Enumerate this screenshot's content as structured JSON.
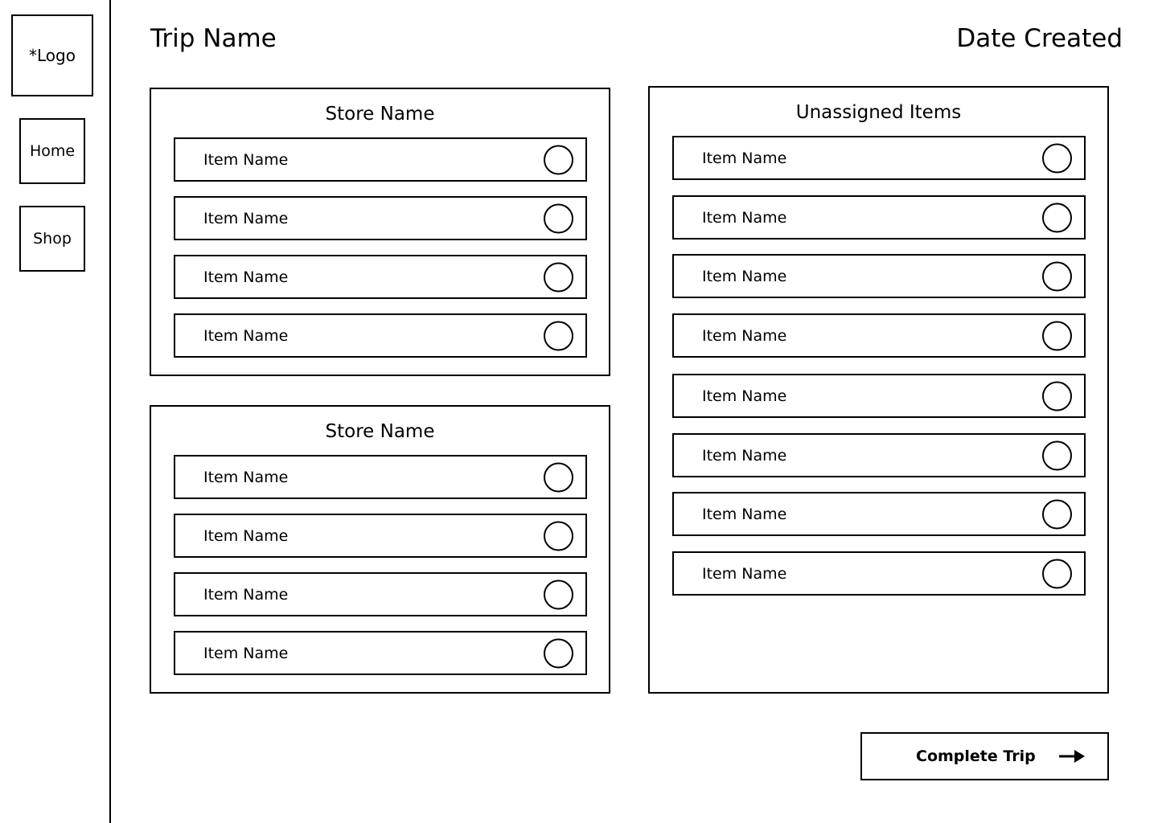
{
  "sidebar": {
    "logo_label": "*Logo",
    "nav": [
      {
        "label": "Home"
      },
      {
        "label": "Shop"
      }
    ]
  },
  "header": {
    "trip_name": "Trip Name",
    "date_created": "Date Created"
  },
  "stores": [
    {
      "title": "Store Name",
      "items": [
        {
          "label": "Item Name",
          "checked": false
        },
        {
          "label": "Item Name",
          "checked": false
        },
        {
          "label": "Item Name",
          "checked": false
        },
        {
          "label": "Item Name",
          "checked": false
        }
      ]
    },
    {
      "title": "Store Name",
      "items": [
        {
          "label": "Item Name",
          "checked": false
        },
        {
          "label": "Item Name",
          "checked": false
        },
        {
          "label": "Item Name",
          "checked": false
        },
        {
          "label": "Item Name",
          "checked": false
        }
      ]
    }
  ],
  "unassigned": {
    "title": "Unassigned Items",
    "items": [
      {
        "label": "Item Name",
        "checked": false
      },
      {
        "label": "Item Name",
        "checked": false
      },
      {
        "label": "Item Name",
        "checked": false
      },
      {
        "label": "Item Name",
        "checked": false
      },
      {
        "label": "Item Name",
        "checked": false
      },
      {
        "label": "Item Name",
        "checked": false
      },
      {
        "label": "Item Name",
        "checked": false
      },
      {
        "label": "Item Name",
        "checked": false
      }
    ]
  },
  "footer": {
    "complete_label": "Complete Trip",
    "complete_icon": "arrow-right-icon"
  }
}
